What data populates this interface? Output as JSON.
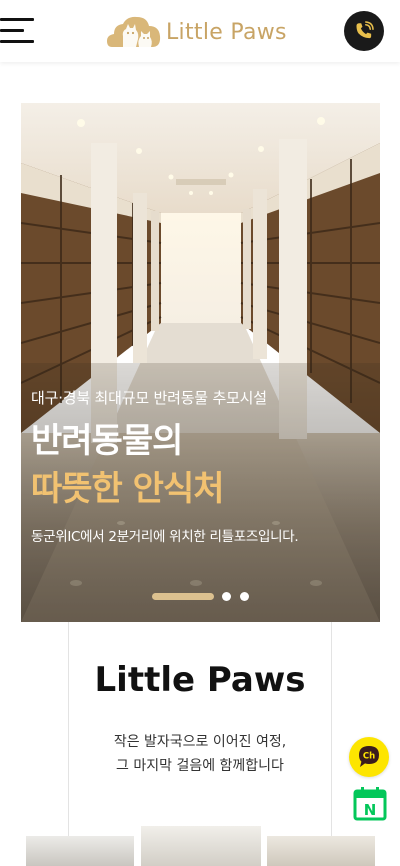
{
  "header": {
    "brand": "Little Paws",
    "menu_icon": "hamburger-menu-icon",
    "call_icon": "phone-call-icon"
  },
  "hero": {
    "subtitle": "대구·경북 최대규모 반려동물 추모시설",
    "title_line1": "반려동물의",
    "title_line2": "따뜻한 안식처",
    "description": "동군위IC에서 2분거리에 위치한 리틀포즈입니다.",
    "slide_count": 3,
    "active_slide": 1,
    "accent_color": "#f2c271"
  },
  "about": {
    "title": "Little Paws",
    "line1": "작은 발자국으로 이어진 여정,",
    "line2": "그 마지막 걸음에 함께합니다"
  },
  "floating": {
    "kakao_label": "Ch",
    "naver_label": "N"
  },
  "colors": {
    "brand_gold": "#c8a465",
    "kakao_yellow": "#fde500",
    "naver_green": "#03c75a"
  }
}
